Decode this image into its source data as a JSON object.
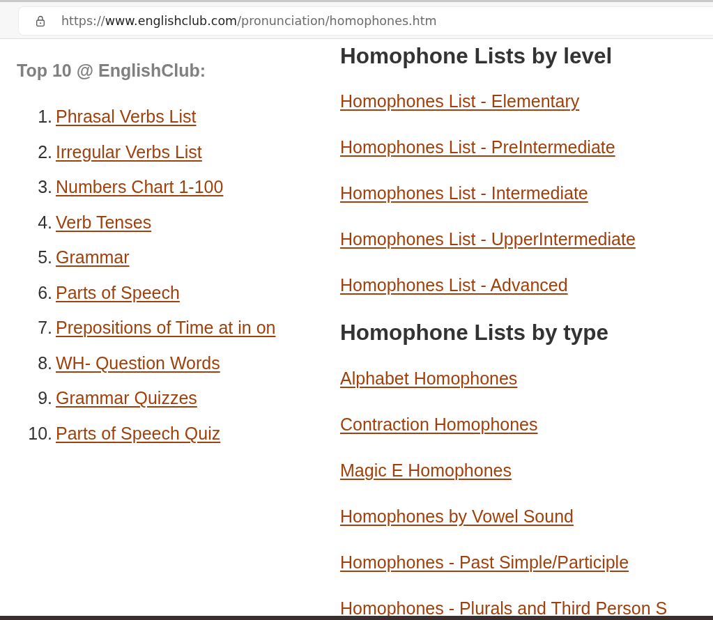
{
  "address_bar": {
    "url": {
      "scheme": "https://",
      "host": "www.englishclub.com",
      "path": "/pronunciation/homophones.htm"
    }
  },
  "sidebar": {
    "heading": "Top 10 @ EnglishClub:",
    "items": [
      {
        "number": "1.",
        "label": "Phrasal Verbs List"
      },
      {
        "number": "2.",
        "label": "Irregular Verbs List"
      },
      {
        "number": "3.",
        "label": "Numbers Chart 1-100"
      },
      {
        "number": "4.",
        "label": "Verb Tenses"
      },
      {
        "number": "5.",
        "label": "Grammar"
      },
      {
        "number": "6.",
        "label": "Parts of Speech"
      },
      {
        "number": "7.",
        "label": "Prepositions of Time at in on"
      },
      {
        "number": "8.",
        "label": "WH- Question Words"
      },
      {
        "number": "9.",
        "label": "Grammar Quizzes"
      },
      {
        "number": "10.",
        "label": "Parts of Speech Quiz"
      }
    ]
  },
  "main": {
    "sections": [
      {
        "heading": "Homophone Lists by level",
        "links": [
          "Homophones List - Elementary",
          "Homophones List - PreIntermediate",
          "Homophones List - Intermediate",
          "Homophones List - UpperIntermediate",
          "Homophones List - Advanced"
        ]
      },
      {
        "heading": "Homophone Lists by type",
        "links": [
          "Alphabet Homophones",
          "Contraction Homophones",
          "Magic E Homophones",
          "Homophones by Vowel Sound",
          "Homophones - Past Simple/Participle",
          "Homophones - Plurals and Third Person S"
        ]
      }
    ]
  }
}
